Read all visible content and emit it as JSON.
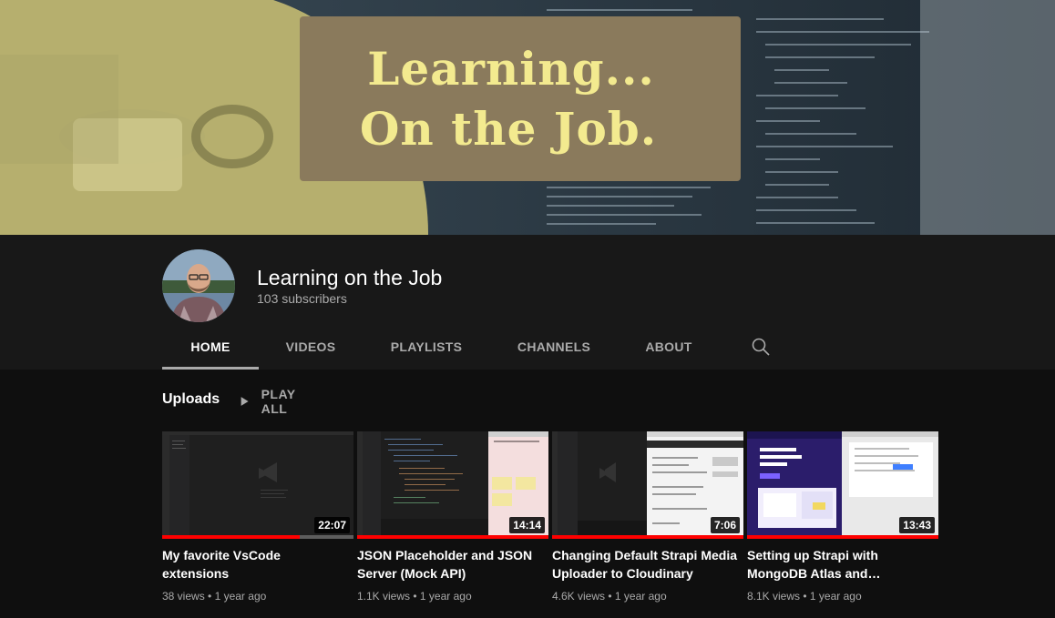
{
  "banner": {
    "line1": "Learning...",
    "line2": "On the Job.",
    "colors": {
      "olive": "#c9c27a",
      "dark": "#2d3b46",
      "card": "#8a7a5c",
      "text": "#f3ea8f"
    }
  },
  "channel": {
    "name": "Learning on the Job",
    "subscribers": "103 subscribers"
  },
  "tabs": [
    {
      "label": "HOME",
      "active": true
    },
    {
      "label": "VIDEOS",
      "active": false
    },
    {
      "label": "PLAYLISTS",
      "active": false
    },
    {
      "label": "CHANNELS",
      "active": false
    },
    {
      "label": "ABOUT",
      "active": false
    }
  ],
  "search_icon": "search-icon",
  "section": {
    "title": "Uploads",
    "play_all": "PLAY ALL"
  },
  "videos": [
    {
      "title": "My favorite VsCode extensions",
      "duration": "22:07",
      "views": "38 views",
      "age": "1 year ago",
      "watched_fraction": 0.72
    },
    {
      "title": "JSON Placeholder and JSON Server (Mock API)",
      "duration": "14:14",
      "views": "1.1K views",
      "age": "1 year ago",
      "watched_fraction": 1.0
    },
    {
      "title": "Changing Default Strapi Media Uploader to Cloudinary",
      "duration": "7:06",
      "views": "4.6K views",
      "age": "1 year ago",
      "watched_fraction": 1.0
    },
    {
      "title": "Setting up Strapi with MongoDB Atlas and…",
      "duration": "13:43",
      "views": "8.1K views",
      "age": "1 year ago",
      "watched_fraction": 1.0
    }
  ],
  "meta_separator": "•"
}
